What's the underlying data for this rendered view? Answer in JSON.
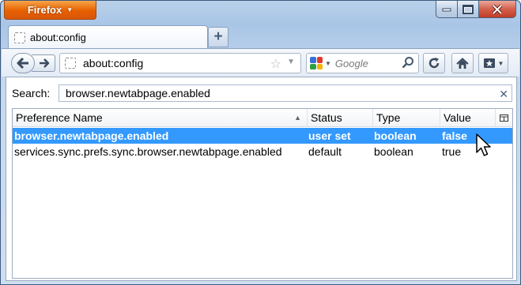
{
  "app_menu": {
    "label": "Firefox"
  },
  "tabs": [
    {
      "title": "about:config"
    }
  ],
  "navbar": {
    "url": "about:config",
    "search_engine_placeholder": "Google"
  },
  "config": {
    "search_label": "Search:",
    "search_value": "browser.newtabpage.enabled",
    "columns": [
      "Preference Name",
      "Status",
      "Type",
      "Value"
    ],
    "rows": [
      {
        "name": "browser.newtabpage.enabled",
        "status": "user set",
        "type": "boolean",
        "value": "false",
        "selected": true
      },
      {
        "name": "services.sync.prefs.sync.browser.newtabpage.enabled",
        "status": "default",
        "type": "boolean",
        "value": "true",
        "selected": false
      }
    ]
  },
  "colors": {
    "firefox_orange": "#e66000",
    "selection": "#3399ff",
    "close_red": "#c03c24"
  }
}
